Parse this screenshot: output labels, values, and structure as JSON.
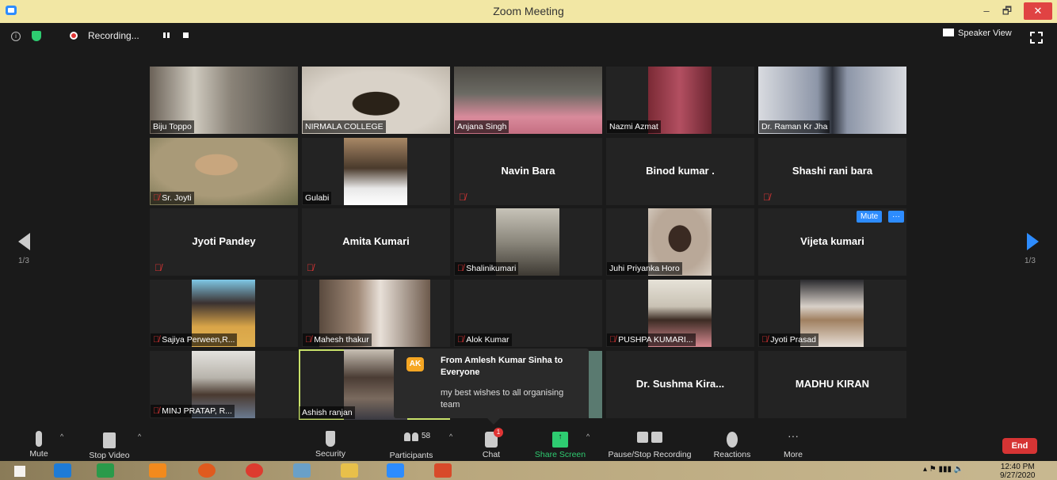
{
  "window": {
    "title": "Zoom Meeting",
    "minimize": "–",
    "maximize": "🗗",
    "close": "✕"
  },
  "topbar": {
    "recording_label": "Recording...",
    "speaker_view_label": "Speaker View"
  },
  "pagination": {
    "left": "1/3",
    "right": "1/3"
  },
  "participants": [
    {
      "name": "Biju Toppo",
      "video": true,
      "muted": false
    },
    {
      "name": "NIRMALA COLLEGE",
      "video": true,
      "muted": false
    },
    {
      "name": "Anjana Singh",
      "video": true,
      "muted": false
    },
    {
      "name": "Nazmi Azmat",
      "video": true,
      "muted": false
    },
    {
      "name": "Dr. Raman Kr Jha",
      "video": true,
      "muted": false
    },
    {
      "name": "Sr. Joyti",
      "video": true,
      "muted": true
    },
    {
      "name": "Gulabi",
      "video": true,
      "muted": false
    },
    {
      "name": "Navin Bara",
      "video": false,
      "muted": true
    },
    {
      "name": "Binod kumar .",
      "video": false,
      "muted": false
    },
    {
      "name": "Shashi rani bara",
      "video": false,
      "muted": true
    },
    {
      "name": "Jyoti Pandey",
      "video": false,
      "muted": true
    },
    {
      "name": "Amita Kumari",
      "video": false,
      "muted": true
    },
    {
      "name": "Shalinikumari",
      "video": true,
      "muted": true
    },
    {
      "name": "Juhi Priyanka Horo",
      "video": true,
      "muted": false
    },
    {
      "name": "Vijeta kumari",
      "video": false,
      "muted": false
    },
    {
      "name": "Sajiya Perween,R...",
      "video": true,
      "muted": true
    },
    {
      "name": "Mahesh thakur",
      "video": true,
      "muted": true
    },
    {
      "name": "Alok Kumar",
      "video": false,
      "muted": true
    },
    {
      "name": "PUSHPA KUMARI...",
      "video": true,
      "muted": true
    },
    {
      "name": "Jyoti Prasad",
      "video": true,
      "muted": true
    },
    {
      "name": "MINJ PRATAP, R...",
      "video": true,
      "muted": true
    },
    {
      "name": "Ashish ranjan",
      "video": true,
      "muted": false
    },
    {
      "name": "",
      "video": false,
      "muted": false
    },
    {
      "name": "Dr. Sushma Kira...",
      "video": false,
      "muted": false
    },
    {
      "name": "MADHU KIRAN",
      "video": false,
      "muted": false
    }
  ],
  "hover_controls": {
    "mute": "Mute",
    "more": "···"
  },
  "chat_notification": {
    "initials": "AK",
    "from": "From Amlesh Kumar Sinha to Everyone",
    "message": "my best wishes  to all organising team"
  },
  "toolbar": {
    "mute": "Mute",
    "stop_video": "Stop Video",
    "security": "Security",
    "participants": "Participants",
    "participant_count": "58",
    "chat": "Chat",
    "chat_badge": "1",
    "share_screen": "Share Screen",
    "pause_stop_recording": "Pause/Stop Recording",
    "reactions": "Reactions",
    "more": "More",
    "more_glyph": "···",
    "end": "End"
  },
  "taskbar": {
    "time": "12:40 PM",
    "date": "9/27/2020"
  },
  "colors": {
    "accent": "#2d8cff",
    "muted_red": "#e03535",
    "end_red": "#d63434",
    "share_green": "#2ecc71"
  }
}
